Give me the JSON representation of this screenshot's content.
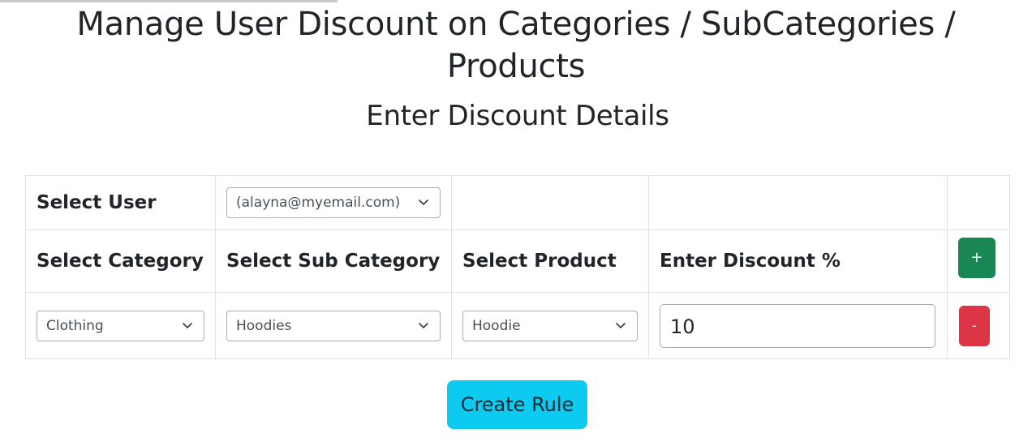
{
  "header": {
    "title": "Manage User Discount on Categories / SubCategories / Products",
    "subtitle": "Enter Discount Details"
  },
  "form": {
    "user_row": {
      "label": "Select User",
      "user_select": {
        "selected": "(alayna@myemail.com)",
        "icon": "chevron-down-icon"
      }
    },
    "columns": [
      "Select Category",
      "Select Sub Category",
      "Select Product",
      "Enter Discount %"
    ],
    "add_button": {
      "label": "+",
      "color": "#198754"
    },
    "rows": [
      {
        "category": "Clothing",
        "sub_category": "Hoodies",
        "product": "Hoodie",
        "discount": "10",
        "remove_button": {
          "label": "-",
          "color": "#dc3545"
        }
      }
    ]
  },
  "actions": {
    "create_rule_label": "Create Rule",
    "create_rule_color": "#0dcaf0"
  }
}
